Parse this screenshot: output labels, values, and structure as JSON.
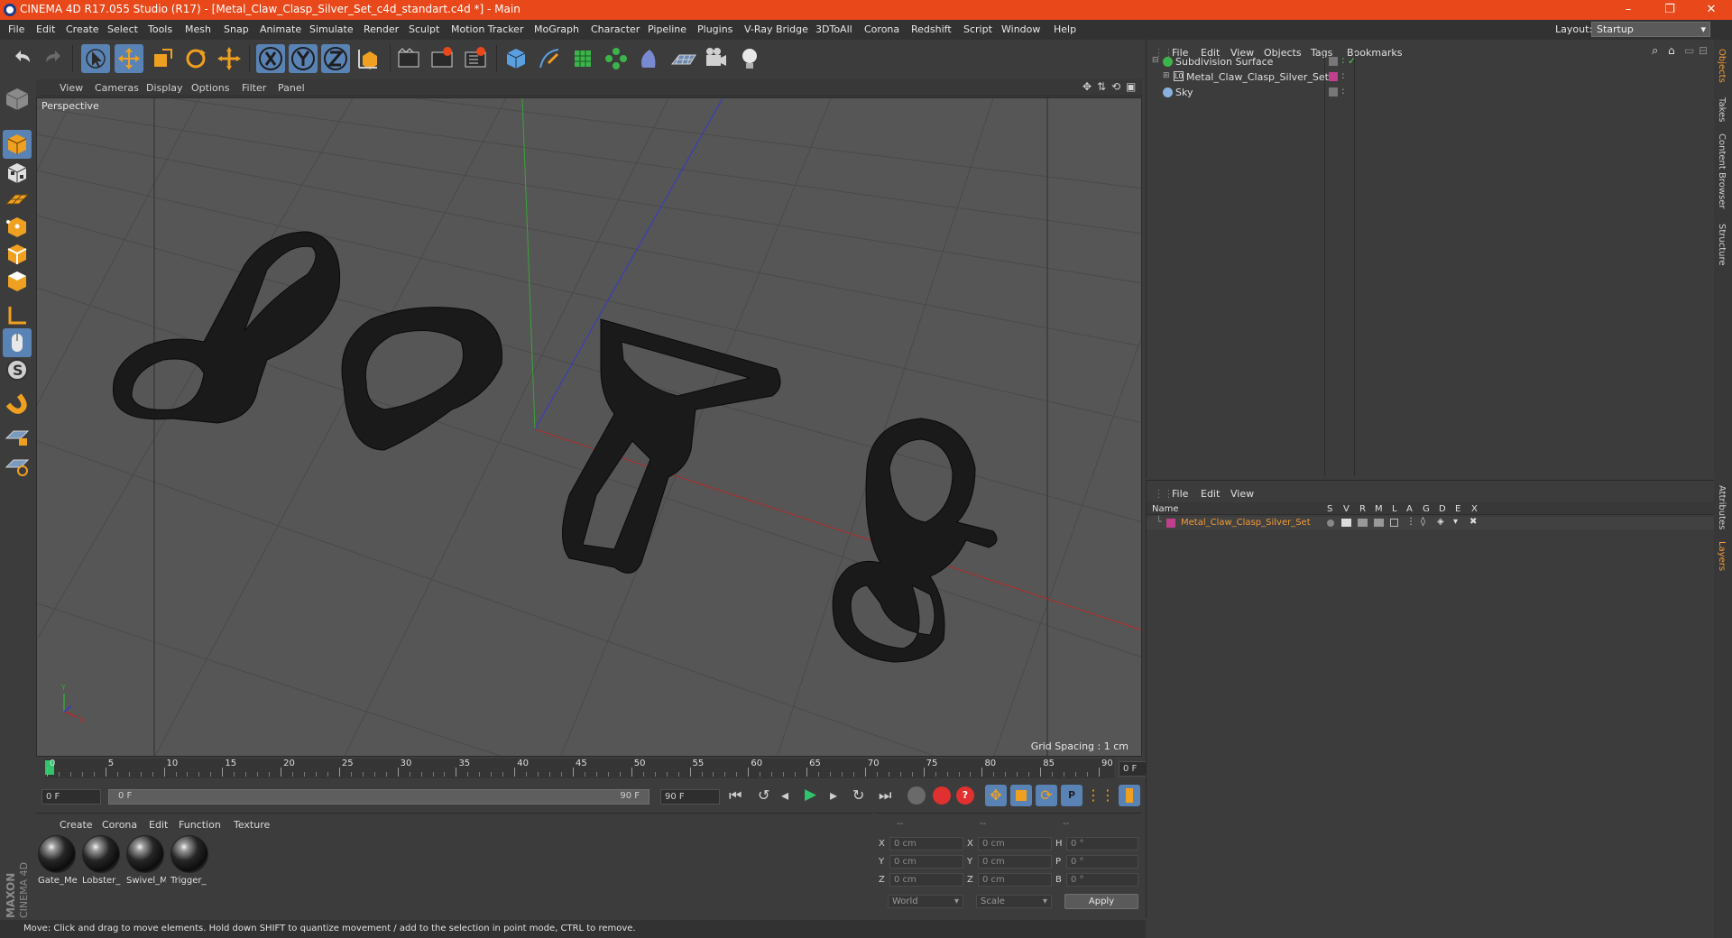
{
  "window": {
    "title": "CINEMA 4D R17.055 Studio (R17) - [Metal_Claw_Clasp_Silver_Set_c4d_standart.c4d *] - Main",
    "controls": [
      "–",
      "❐",
      "✕"
    ]
  },
  "menubar": {
    "items": [
      "File",
      "Edit",
      "Create",
      "Select",
      "Tools",
      "Mesh",
      "Snap",
      "Animate",
      "Simulate",
      "Render",
      "Sculpt",
      "Motion Tracker",
      "MoGraph",
      "Character",
      "Pipeline",
      "Plugins",
      "V-Ray Bridge",
      "3DToAll",
      "Corona",
      "Redshift",
      "Script",
      "Window",
      "Help"
    ],
    "layout_label": "Layout:",
    "layout_value": "Startup"
  },
  "toolbar": {
    "icons": [
      "undo-icon",
      "redo-icon",
      "select-icon",
      "move-icon",
      "scale-icon",
      "rotate-icon",
      "move-plus-icon",
      "x-axis-icon",
      "y-axis-icon",
      "z-axis-icon",
      "coordinate-system-icon",
      "render-view-icon",
      "render-picture-viewer-icon",
      "edit-render-settings-icon",
      "cube-icon",
      "pen-icon",
      "subdivision-icon",
      "array-icon",
      "deformer-icon",
      "floor-icon",
      "camera-icon",
      "light-icon"
    ]
  },
  "left_toolbar": {
    "icons": [
      "make-editable-icon",
      "model-mode-icon",
      "texture-mode-icon",
      "workplane-icon",
      "points-mode-icon",
      "edges-mode-icon",
      "polygons-mode-icon",
      "axis-icon",
      "tweak-icon",
      "snap-icon",
      "magnet-icon",
      "locked-workplane-icon",
      "planar-workplane-icon"
    ]
  },
  "viewport": {
    "menu": [
      "View",
      "Cameras",
      "Display",
      "Options",
      "Filter",
      "Panel"
    ],
    "label": "Perspective",
    "grid_spacing": "Grid Spacing : 1 cm",
    "axis_gizmo": {
      "x": "X",
      "y": "Y"
    }
  },
  "timeline": {
    "ticks": [
      "0",
      "5",
      "10",
      "15",
      "20",
      "25",
      "30",
      "35",
      "40",
      "45",
      "50",
      "55",
      "60",
      "65",
      "70",
      "75",
      "80",
      "85",
      "90"
    ],
    "current_frame": "0 F",
    "start": "0 F",
    "range_start": "0 F",
    "range_end": "90 F",
    "end": "90 F"
  },
  "material_manager": {
    "menu": [
      "Create",
      "Corona",
      "Edit",
      "Function",
      "Texture"
    ],
    "materials": [
      "Gate_Me",
      "Lobster_",
      "Swivel_M",
      "Trigger_"
    ]
  },
  "attributes": {
    "headers": [
      "--",
      "--",
      "--"
    ],
    "rows": [
      {
        "a": "X",
        "av": "0 cm",
        "b": "X",
        "bv": "0 cm",
        "c": "H",
        "cv": "0 °"
      },
      {
        "a": "Y",
        "av": "0 cm",
        "b": "Y",
        "bv": "0 cm",
        "c": "P",
        "cv": "0 °"
      },
      {
        "a": "Z",
        "av": "0 cm",
        "b": "Z",
        "bv": "0 cm",
        "c": "B",
        "cv": "0 °"
      }
    ],
    "coord_system": "World",
    "mode": "Scale",
    "apply": "Apply"
  },
  "status_bar": {
    "text": "Move: Click and drag to move elements. Hold down SHIFT to quantize movement / add to the selection in point mode, CTRL to remove."
  },
  "branding": {
    "line1": "MAXON",
    "line2": "CINEMA 4D"
  },
  "objects_panel": {
    "menu": [
      "File",
      "Edit",
      "View",
      "Objects",
      "Tags",
      "Bookmarks"
    ],
    "objects": [
      "Subdivision Surface",
      "Metal_Claw_Clasp_Silver_Set",
      "Sky"
    ]
  },
  "layers_panel": {
    "menu": [
      "File",
      "Edit",
      "View"
    ],
    "columns": [
      "Name",
      "S",
      "V",
      "R",
      "M",
      "L",
      "A",
      "G",
      "D",
      "E",
      "X"
    ],
    "layers": [
      {
        "name": "Metal_Claw_Clasp_Silver_Set",
        "color": "#c03f8e"
      }
    ]
  },
  "side_tabs": {
    "top": [
      "Objects",
      "Takes",
      "Content Browser",
      "Structure"
    ],
    "bottom": [
      "Attributes",
      "Layers"
    ]
  },
  "colors": {
    "title_bar": "#e8481a",
    "selection": "#5a83b5",
    "accent": "#f29a36",
    "x_axis": "#b32a2a",
    "y_axis": "#3aa33a",
    "z_axis": "#3838c8"
  }
}
